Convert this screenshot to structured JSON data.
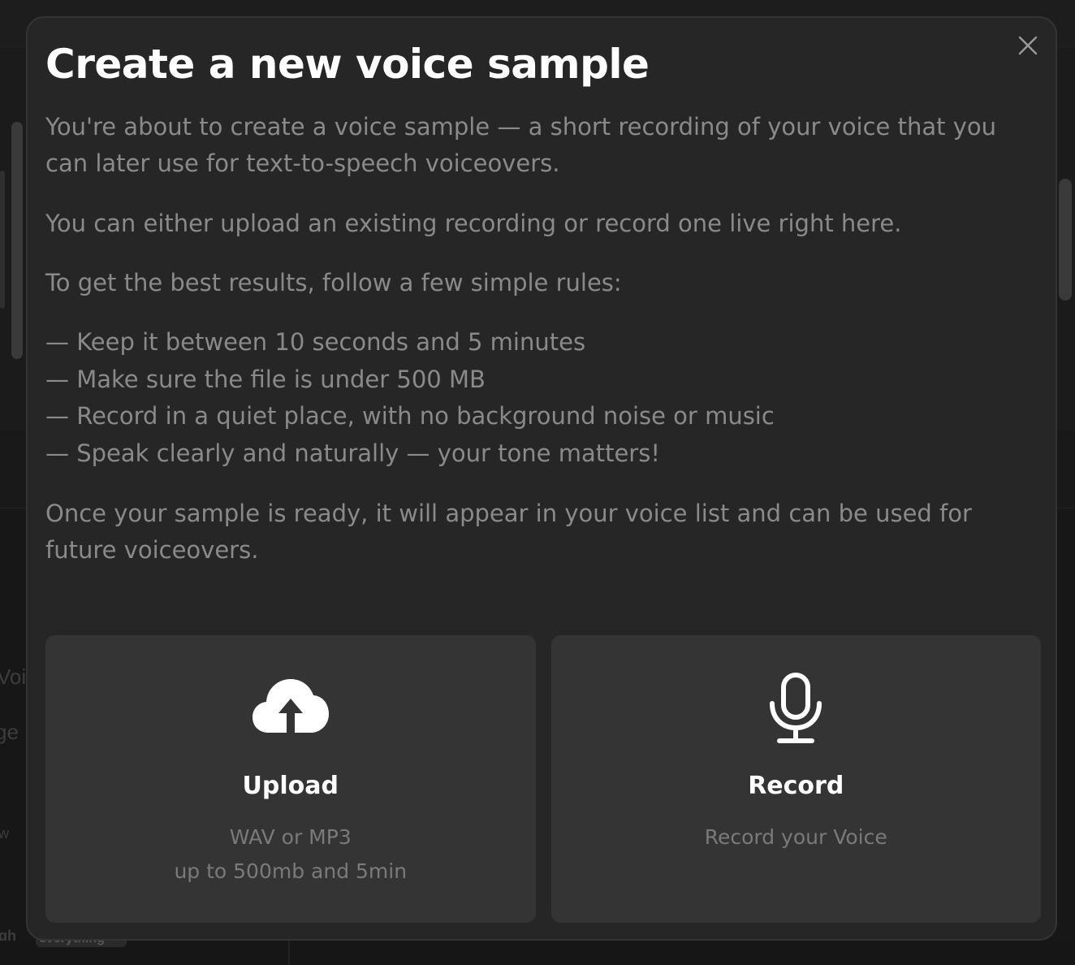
{
  "modal": {
    "title": "Create a new voice sample",
    "intro": "You're about to create a voice sample — a short recording of your voice that you can later use for text-to-speech voiceovers.",
    "either": "You can either upload an existing recording or record one live right here.",
    "rules_heading": "To get the best results, follow a few simple rules:",
    "rules": [
      "— Keep it between 10 seconds and 5 minutes",
      "— Make sure the file is under 500 MB",
      "— Record in a quiet place, with no background noise or music",
      "— Speak clearly and naturally — your tone matters!"
    ],
    "outro": "Once your sample is ready, it will appear in your voice list and can be used for future voiceovers.",
    "close_icon": "close-icon"
  },
  "cards": {
    "upload": {
      "icon": "cloud-upload-icon",
      "title": "Upload",
      "line1": "WAV or MP3",
      "line2": "up to 500mb and 5min"
    },
    "record": {
      "icon": "microphone-icon",
      "title": "Record",
      "line1": "Record your Voice"
    }
  },
  "background": {
    "fragments": [
      "Voic",
      "ge",
      "w",
      "gh",
      "everything"
    ]
  },
  "colors": {
    "modal_bg": "#262626",
    "card_bg": "#343434",
    "text_muted": "#8a8a8a",
    "title": "#ffffff"
  }
}
